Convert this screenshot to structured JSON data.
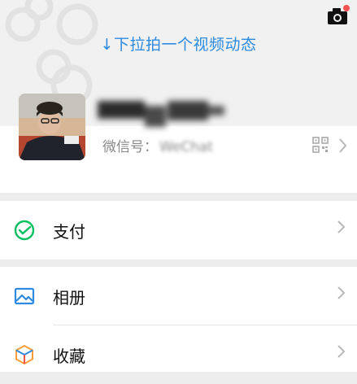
{
  "header": {
    "pull_hint": "↓下拉拍一个视频动态",
    "camera_icon": "camera-icon",
    "notification_dot_color": "#fa5151"
  },
  "profile": {
    "wechat_id_label": "微信号：",
    "wechat_id_value": "WeChat",
    "qr_icon": "qrcode-icon"
  },
  "menu": {
    "pay": {
      "label": "支付",
      "icon": "wechat-pay-icon",
      "color": "#07c160"
    },
    "album": {
      "label": "相册",
      "icon": "album-icon",
      "color": "#2c8be0"
    },
    "favorites": {
      "label": "收藏",
      "icon": "favorites-cube-icon",
      "color": "#fa9d3b"
    }
  },
  "colors": {
    "accent_blue": "#2c8be0",
    "background": "#ededed"
  }
}
